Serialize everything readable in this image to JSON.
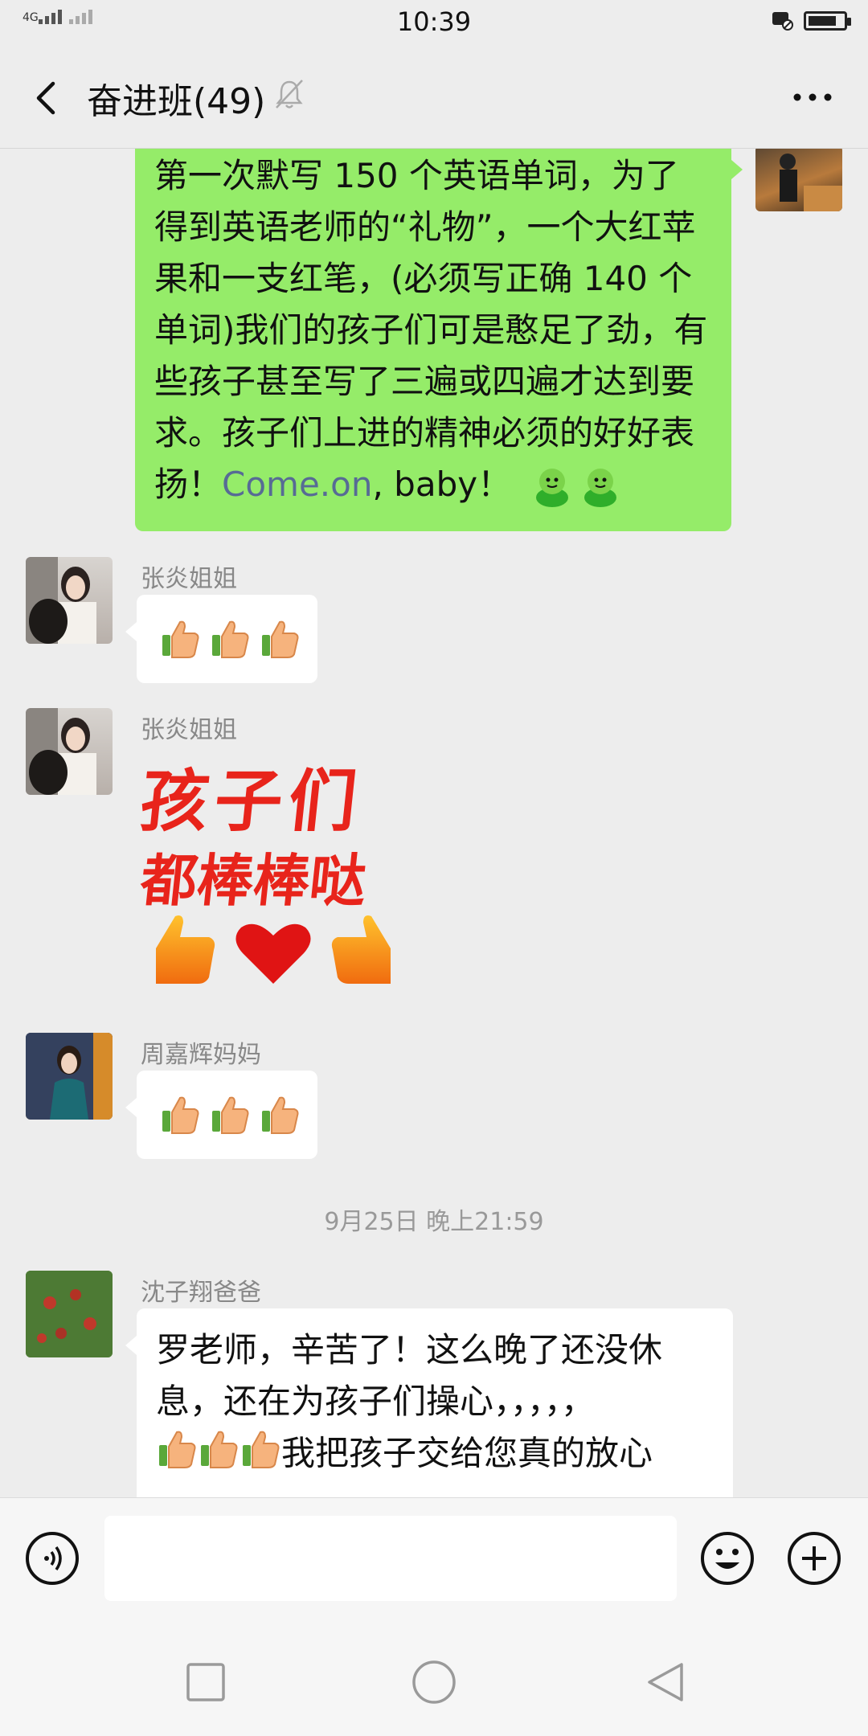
{
  "status": {
    "time": "10:39",
    "network": "4G"
  },
  "header": {
    "title": "奋进班(49)"
  },
  "messages": {
    "m1_text": "第一次默写 150 个英语单词，为了得到英语老师的“礼物”，一个大红苹果和一支红笔，(必须写正确 140 个单词)我们的孩子们可是憨足了劲，有些孩子甚至写了三遍或四遍才达到要求。孩子们上进的精神必须的好好表扬！",
    "m1_link": "Come.on",
    "m1_tail": ", baby！",
    "m2_sender": "张炎姐姐",
    "m3_sender": "张炎姐姐",
    "m3_sticker_line1": "孩子们",
    "m3_sticker_line2": "都棒棒哒",
    "m4_sender": "周嘉辉妈妈",
    "timestamp": "9月25日 晚上21:59",
    "m5_sender": "沈子翔爸爸",
    "m5_text_a": "罗老师，辛苦了！这么晚了还没休息，还在为孩子们操心，，，，，",
    "m5_text_b": "我把孩子交给您真的放心"
  },
  "icons": [
    "back-icon",
    "mute-bell-icon",
    "more-icon",
    "voice-icon",
    "emoji-icon",
    "plus-icon",
    "square-nav-icon",
    "circle-nav-icon",
    "triangle-nav-icon",
    "thumbs-up-icon",
    "green-emoji-icon"
  ]
}
